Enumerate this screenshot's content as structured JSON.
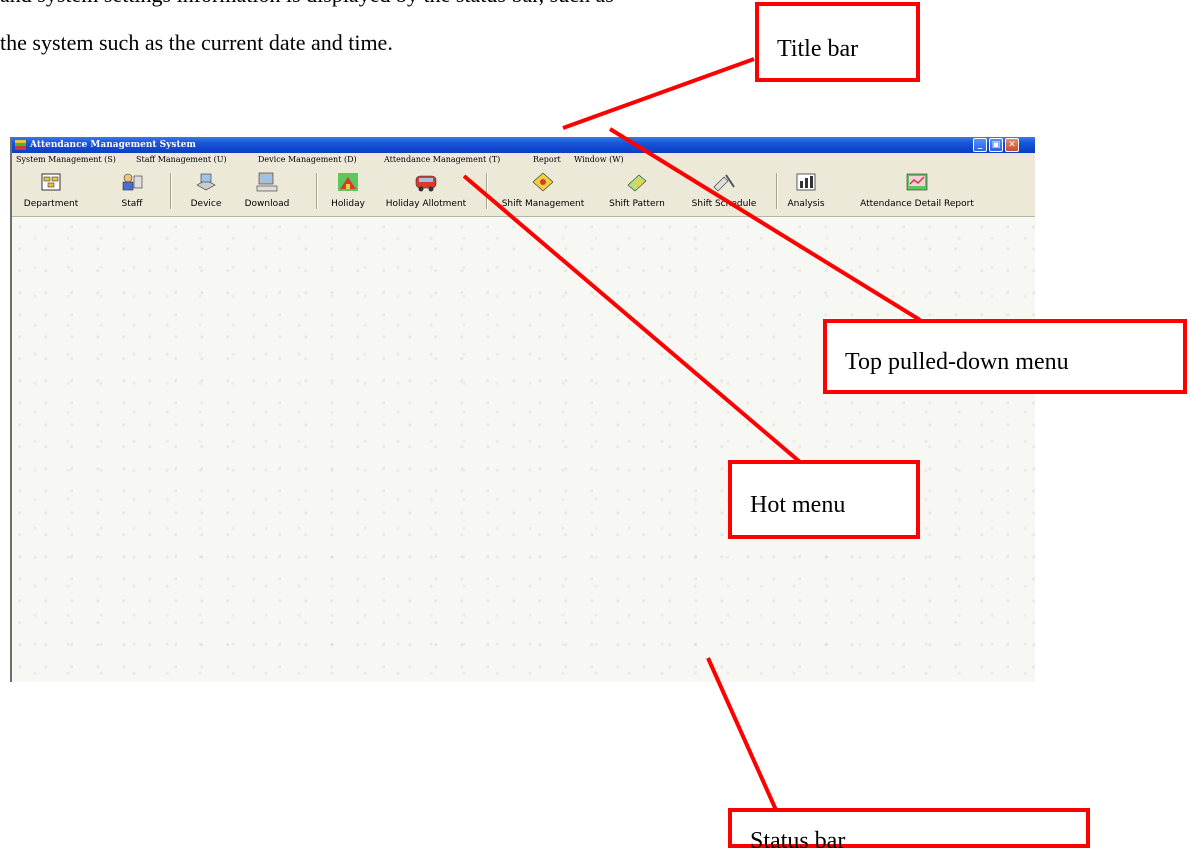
{
  "doc": {
    "intro_line": "the system such as the current date and time.",
    "intro_top_line": "and system settings information is displayed by the status bar, such as information on"
  },
  "window": {
    "title": "Attendance Management System",
    "controls": {
      "minimize": "_",
      "restore": "▣",
      "close": "✕"
    }
  },
  "menubar": {
    "items": [
      "System Management (S)",
      "Staff Management (U)",
      "Device Management (D)",
      "Attendance Management (T)",
      "Report",
      "Window (W)"
    ]
  },
  "toolbar": {
    "items": [
      {
        "label": "Department",
        "icon": "department-icon"
      },
      {
        "label": "Staff",
        "icon": "staff-icon"
      },
      {
        "label": "Device",
        "icon": "device-icon"
      },
      {
        "label": "Download",
        "icon": "download-icon"
      },
      {
        "label": "Holiday",
        "icon": "holiday-icon"
      },
      {
        "label": "Holiday Allotment",
        "icon": "holiday-allotment-icon"
      },
      {
        "label": "Shift Management",
        "icon": "shift-management-icon"
      },
      {
        "label": "Shift Pattern",
        "icon": "shift-pattern-icon"
      },
      {
        "label": "Shift Schedule",
        "icon": "shift-schedule-icon"
      },
      {
        "label": "Analysis",
        "icon": "analysis-icon"
      },
      {
        "label": "Attendance Detail Report",
        "icon": "report-icon"
      }
    ]
  },
  "callouts": {
    "title_bar": "Title bar",
    "top_menu": "Top pulled-down menu",
    "hot_menu": "Hot menu",
    "status_bar": "Status bar"
  },
  "colors": {
    "callout_border": "#ff0000",
    "titlebar": "#1653d9",
    "menubar": "#ece9d8"
  }
}
